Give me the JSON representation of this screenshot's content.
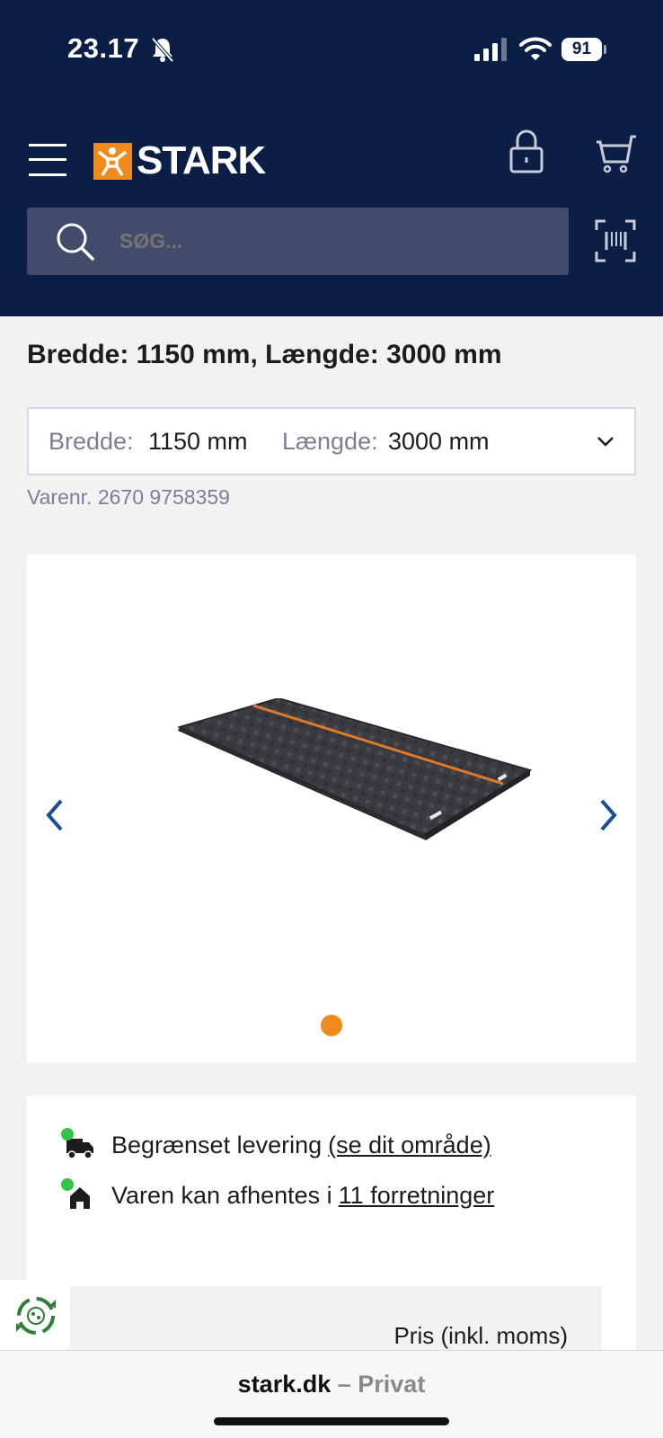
{
  "status_bar": {
    "time": "23.17",
    "battery": "91"
  },
  "header": {
    "brand": "STARK",
    "search_placeholder": "SØG..."
  },
  "product": {
    "title": "Bredde: 1150 mm, Længde: 3000 mm",
    "variant": {
      "width_label": "Bredde:",
      "width_value": "1150 mm",
      "length_label": "Længde:",
      "length_value": "3000 mm"
    },
    "sku": "Varenr. 2670 9758359",
    "image_count": 1,
    "active_image": 1
  },
  "availability": {
    "delivery_text": "Begrænset levering",
    "delivery_link": "(se dit område)",
    "pickup_text": "Varen kan afhentes i",
    "pickup_link": "11 forretninger",
    "status_color": "#2fc44a"
  },
  "price": {
    "label": "Pris (inkl. moms)"
  },
  "browser": {
    "domain": "stark.dk",
    "suffix": "– Privat"
  },
  "colors": {
    "header_bg": "#0b1e45",
    "accent": "#f18a1d",
    "search_bg": "#434b6b"
  }
}
